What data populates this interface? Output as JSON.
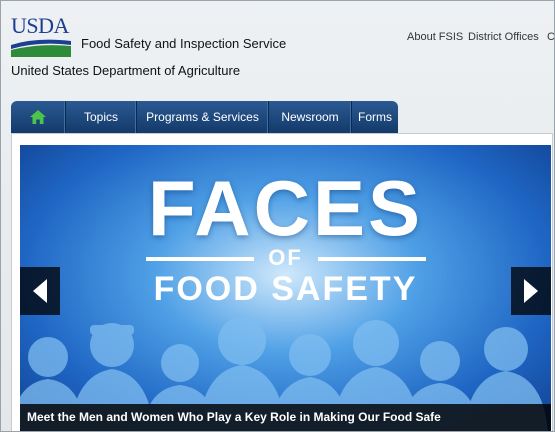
{
  "header": {
    "logo_text": "USDA",
    "agency": "Food Safety and Inspection Service",
    "department": "United States Department of Agriculture",
    "utility_links": [
      "About FSIS",
      "District Offices",
      "C"
    ]
  },
  "nav": {
    "home_icon": "home-icon",
    "items": [
      "Topics",
      "Programs & Services",
      "Newsroom",
      "Forms"
    ]
  },
  "hero": {
    "title_line1": "FACES",
    "title_line2": "OF",
    "title_line3": "FOOD SAFETY",
    "caption": "Meet the Men and Women Who Play a Key Role in Making Our Food Safe",
    "prev_icon": "chevron-left-icon",
    "next_icon": "chevron-right-icon"
  },
  "colors": {
    "nav_blue": "#1e4a7f",
    "usda_blue": "#1c3f94",
    "usda_green": "#2e7d32",
    "hero_blue": "#1f66c4"
  }
}
